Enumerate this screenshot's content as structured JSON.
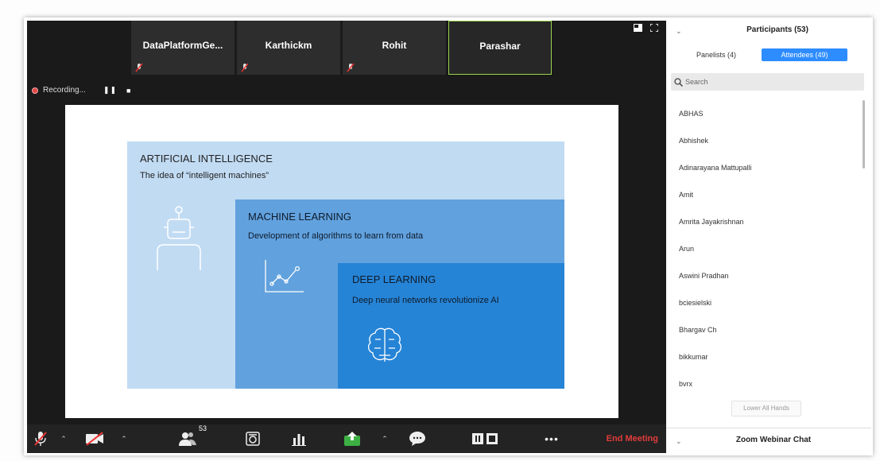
{
  "video": {
    "tiles": [
      {
        "name": "DataPlatformGe..."
      },
      {
        "name": "Karthickm"
      },
      {
        "name": "Rohit"
      },
      {
        "name": "Parashar"
      }
    ],
    "recording_label": "Recording..."
  },
  "slide": {
    "ai": {
      "title": "ARTIFICIAL INTELLIGENCE",
      "subtitle": "The idea of “intelligent machines”"
    },
    "ml": {
      "title": "MACHINE LEARNING",
      "subtitle": "Development of algorithms to learn from data"
    },
    "dl": {
      "title": "DEEP LEARNING",
      "subtitle": "Deep neural networks revolutionize AI"
    }
  },
  "toolbar": {
    "participants_count": "53",
    "end_label": "End Meeting"
  },
  "panel": {
    "title": "Participants (53)",
    "tabs": [
      {
        "label": "Panelists (4)",
        "active": false
      },
      {
        "label": "Attendees (49)",
        "active": true
      }
    ],
    "search_placeholder": "Search",
    "attendees": [
      "ABHAS",
      "Abhishek",
      "Adinarayana Mattupalli",
      "Amit",
      "Amrita Jayakrishnan",
      "Arun",
      "Aswini Pradhan",
      "bciesielski",
      "Bhargav Ch",
      "bikkumar",
      "bvrx"
    ],
    "lower_all_hands": "Lower All Hands",
    "chat_title": "Zoom Webinar Chat"
  },
  "colors": {
    "accent": "#2d8cff",
    "ai_box": "#c1dbf3",
    "ml_box": "#61a1de",
    "dl_box": "#2684d6",
    "end_meeting": "#e23b3b",
    "active_tile_border": "#9bd34d"
  },
  "icons": [
    "mute-icon",
    "video-off-icon",
    "participants-icon",
    "qa-icon",
    "polls-icon",
    "share-screen-icon",
    "chat-icon",
    "pause-recording-icon",
    "more-icon",
    "search-icon",
    "robot-icon",
    "chart-icon",
    "brain-icon"
  ]
}
